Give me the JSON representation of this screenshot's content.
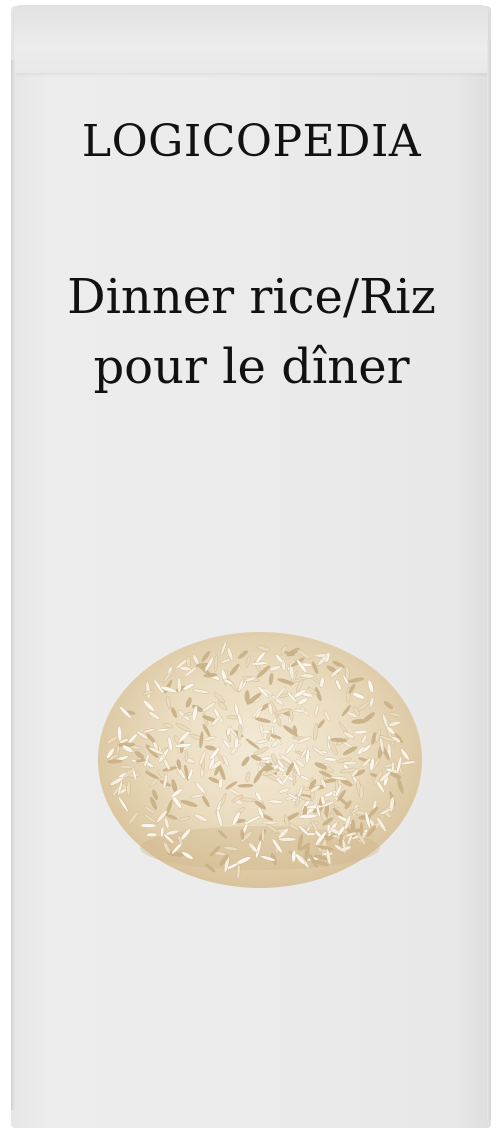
{
  "package": {
    "brand": "LOGICOPEDIA",
    "product_name_en": "Dinner rice/Riz",
    "product_name_fr": "pour le dîner"
  },
  "image": {
    "subject_icon": "rice-pile-icon"
  },
  "colors": {
    "box": "#ebebeb",
    "text": "#111111",
    "rice_light": "#f6efe0",
    "rice_mid": "#e9dcc0",
    "rice_dark": "#cbb48b"
  }
}
